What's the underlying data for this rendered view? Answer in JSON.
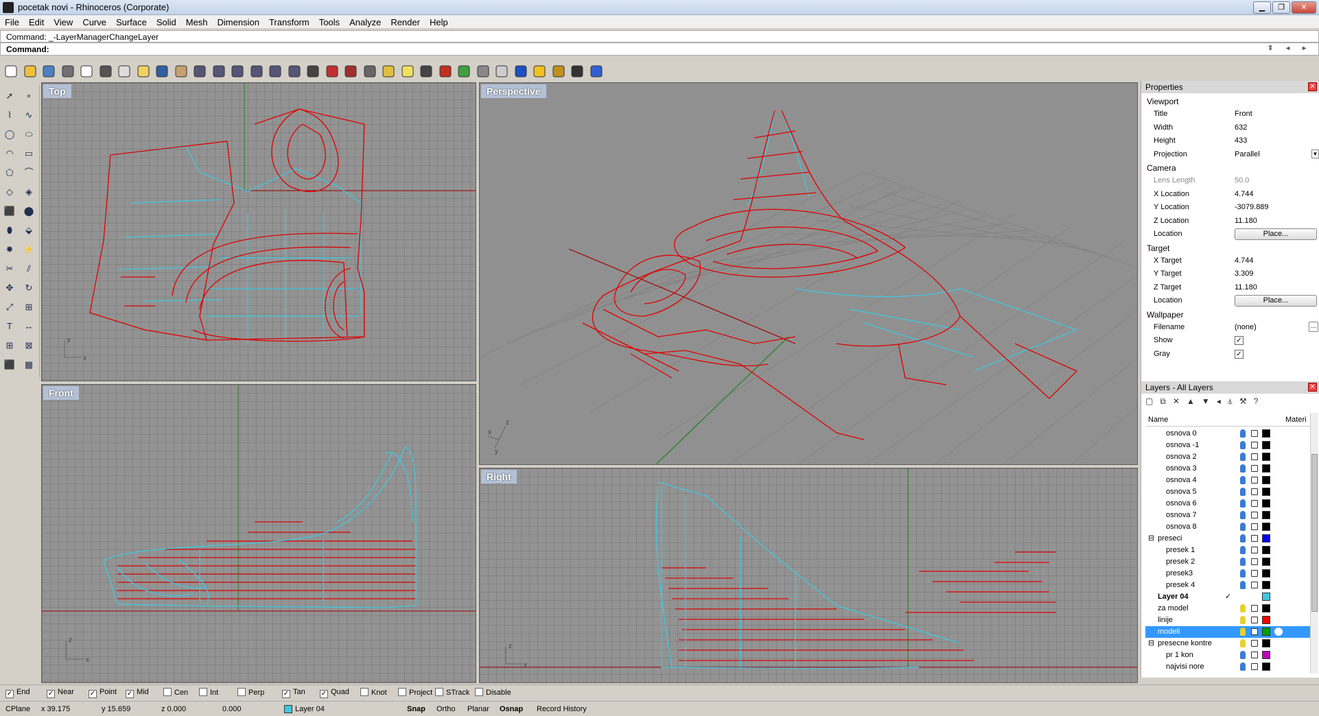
{
  "window": {
    "title": "pocetak novi - Rhinoceros (Corporate)",
    "buttons": [
      "minimize",
      "restore",
      "close"
    ]
  },
  "menu": [
    "File",
    "Edit",
    "View",
    "Curve",
    "Surface",
    "Solid",
    "Mesh",
    "Dimension",
    "Transform",
    "Tools",
    "Analyze",
    "Render",
    "Help"
  ],
  "command": {
    "history": "Command: _-LayerManagerChangeLayer",
    "prompt": "Command:"
  },
  "toolbar_icons": [
    "new-icon",
    "open-icon",
    "save-icon",
    "print-icon",
    "import-icon",
    "cut-icon",
    "copy-icon",
    "paste-icon",
    "undo-icon",
    "pan-icon",
    "rotate-view-icon",
    "zoom-icon",
    "zoom-window-icon",
    "zoom-extents-icon",
    "zoom-selected-icon",
    "undo-view-icon",
    "four-viewports-icon",
    "car-icon",
    "car-wire-icon",
    "camera-icon",
    "lights-icon",
    "bulb-icon",
    "lock-icon",
    "shade-icon",
    "color-wheel-icon",
    "wireframe-sphere-icon",
    "grid-sphere-icon",
    "render-sphere-icon",
    "flag-icon",
    "gear-icon",
    "curve-tools-icon",
    "help-icon"
  ],
  "left_tools": [
    "select-arrow-icon",
    "point-icon",
    "polyline-icon",
    "curve-icon",
    "circle-icon",
    "ellipse-icon",
    "arc-icon",
    "rectangle-icon",
    "polygon-icon",
    "fillet-icon",
    "surface-icon",
    "surface-loft-icon",
    "box-icon",
    "boolean-icon",
    "cylinder-icon",
    "extrude-icon",
    "explode-icon",
    "join-icon",
    "trim-icon",
    "split-icon",
    "move-icon",
    "rotate-icon",
    "scale-icon",
    "array-icon",
    "text-icon",
    "dimension-icon",
    "grid-snap-icon",
    "block-icon",
    "box-solid-icon",
    "hatch-icon"
  ],
  "viewports": {
    "top": "Top",
    "perspective": "Perspective",
    "front": "Front",
    "right": "Right"
  },
  "axis_labels": {
    "x": "x",
    "y": "y",
    "z": "z"
  },
  "colors": {
    "curve_red": "#e00000",
    "curve_cyan": "#40c8e0",
    "viewport_bg": "#939393",
    "selection": "#3399ff"
  },
  "properties": {
    "panel_title": "Properties",
    "section_viewport": "Viewport",
    "rows": [
      {
        "k": "Title",
        "v": "Front"
      },
      {
        "k": "Width",
        "v": "632"
      },
      {
        "k": "Height",
        "v": "433"
      },
      {
        "k": "Projection",
        "v": "Parallel"
      }
    ],
    "section_camera": "Camera",
    "camera": [
      {
        "k": "Lens Length",
        "v": "50.0"
      },
      {
        "k": "X Location",
        "v": "4.744"
      },
      {
        "k": "Y Location",
        "v": "-3079.889"
      },
      {
        "k": "Z Location",
        "v": "11.180"
      },
      {
        "k": "Location",
        "v": "Place..."
      }
    ],
    "section_target": "Target",
    "target": [
      {
        "k": "X Target",
        "v": "4.744"
      },
      {
        "k": "Y Target",
        "v": "3.309"
      },
      {
        "k": "Z Target",
        "v": "11.180"
      },
      {
        "k": "Location",
        "v": "Place..."
      }
    ],
    "section_wallpaper": "Wallpaper",
    "wallpaper": [
      {
        "k": "Filename",
        "v": "(none)"
      },
      {
        "k": "Show",
        "v": "✓"
      },
      {
        "k": "Gray",
        "v": "✓"
      }
    ],
    "browse": "..."
  },
  "layers": {
    "panel_title": "Layers - All Layers",
    "col_name": "Name",
    "col_material": "Materi",
    "current_mark": "✓",
    "rows": [
      {
        "name": "osnova 0",
        "indent": 2,
        "color": "#000000"
      },
      {
        "name": "osnova -1",
        "indent": 2,
        "color": "#000000"
      },
      {
        "name": "osnova 2",
        "indent": 2,
        "color": "#000000"
      },
      {
        "name": "osnova 3",
        "indent": 2,
        "color": "#000000"
      },
      {
        "name": "osnova 4",
        "indent": 2,
        "color": "#000000"
      },
      {
        "name": "osnova 5",
        "indent": 2,
        "color": "#000000"
      },
      {
        "name": "osnova 6",
        "indent": 2,
        "color": "#000000"
      },
      {
        "name": "osnova 7",
        "indent": 2,
        "color": "#000000"
      },
      {
        "name": "osnova 8",
        "indent": 2,
        "color": "#000000"
      },
      {
        "name": "preseci",
        "indent": 1,
        "color": "#0000ff",
        "expander": "⊟"
      },
      {
        "name": "presek 1",
        "indent": 2,
        "color": "#000000"
      },
      {
        "name": "presek 2",
        "indent": 2,
        "color": "#000000"
      },
      {
        "name": "presek3",
        "indent": 2,
        "color": "#000000"
      },
      {
        "name": "presek 4",
        "indent": 2,
        "color": "#000000"
      },
      {
        "name": "Layer 04",
        "indent": 1,
        "color": "#40c8e0",
        "current": true
      },
      {
        "name": "za model",
        "indent": 1,
        "color": "#000000",
        "off": true
      },
      {
        "name": "linije",
        "indent": 1,
        "color": "#ff0000",
        "off": true
      },
      {
        "name": "modeli",
        "indent": 1,
        "color": "#00a000",
        "off": true,
        "selected": true
      },
      {
        "name": "presecne kontre",
        "indent": 1,
        "color": "#000000",
        "expander": "⊟",
        "off": true
      },
      {
        "name": "pr 1 kon",
        "indent": 2,
        "color": "#c000c0"
      },
      {
        "name": "najvisi nore",
        "indent": 2,
        "color": "#000000"
      }
    ]
  },
  "osnap": [
    {
      "label": "End",
      "checked": true
    },
    {
      "label": "Near",
      "checked": true
    },
    {
      "label": "Point",
      "checked": true
    },
    {
      "label": "Mid",
      "checked": true
    },
    {
      "label": "Cen",
      "checked": false
    },
    {
      "label": "Int",
      "checked": false
    },
    {
      "label": "Perp",
      "checked": false
    },
    {
      "label": "Tan",
      "checked": true
    },
    {
      "label": "Quad",
      "checked": true
    },
    {
      "label": "Knot",
      "checked": false
    },
    {
      "label": "Project",
      "checked": false
    },
    {
      "label": "STrack",
      "checked": false
    },
    {
      "label": "Disable",
      "checked": false
    }
  ],
  "status": {
    "cplane": "CPlane",
    "x": "x 39.175",
    "y": "y 15.659",
    "z": "z 0.000",
    "dist": "0.000",
    "layer": "Layer 04",
    "snap": "Snap",
    "ortho": "Ortho",
    "planar": "Planar",
    "osnap": "Osnap",
    "record": "Record History"
  }
}
